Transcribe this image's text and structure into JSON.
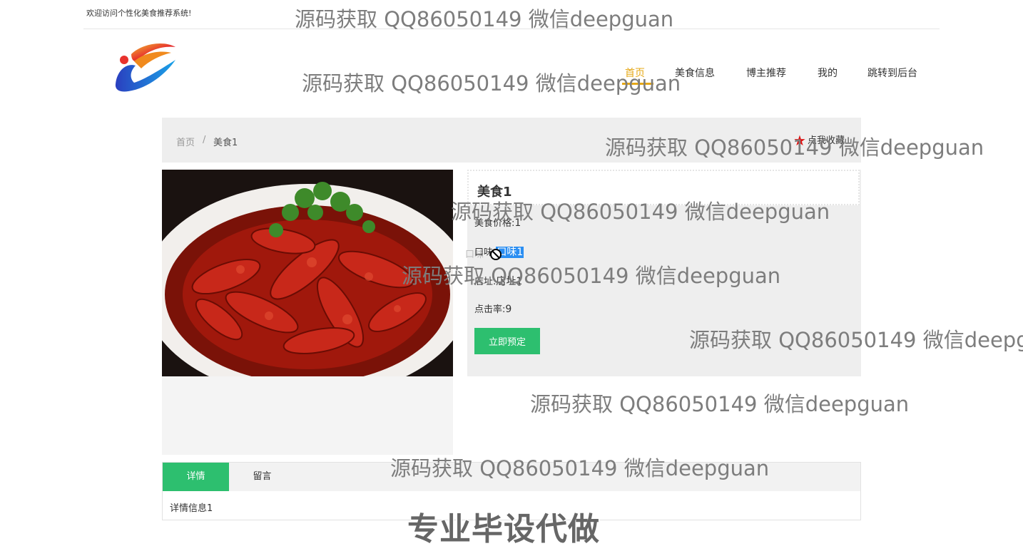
{
  "topbar": {
    "welcome": "欢迎访问个性化美食推荐系统!"
  },
  "nav": {
    "items": [
      "首页",
      "美食信息",
      "博主推荐",
      "我的",
      "跳转到后台"
    ],
    "active_color": "#e6a817"
  },
  "breadcrumb": {
    "home": "首页",
    "separator": "/",
    "current": "美食1"
  },
  "favorite": {
    "label": "点我收藏",
    "icon": "star-icon",
    "icon_color": "#e01010"
  },
  "food": {
    "title": "美食1",
    "price_label": "美食价格:",
    "price": "1",
    "taste_label": "口味:",
    "taste": "口味1",
    "address_label": "店址:",
    "address": "店址1",
    "clicks_label": "点击率:",
    "clicks": "9",
    "ghost_text": "口味",
    "book_button": "立即预定",
    "button_color": "#2dbf6f"
  },
  "tabs": {
    "items": [
      "详情",
      "留言"
    ],
    "active": "详情",
    "content": "详情信息1"
  },
  "watermarks": {
    "repeat": "源码获取 QQ86050149 微信deepguan",
    "last": "源码获取 QQ86050149 微信deepg",
    "banner": "专业毕设代做"
  }
}
